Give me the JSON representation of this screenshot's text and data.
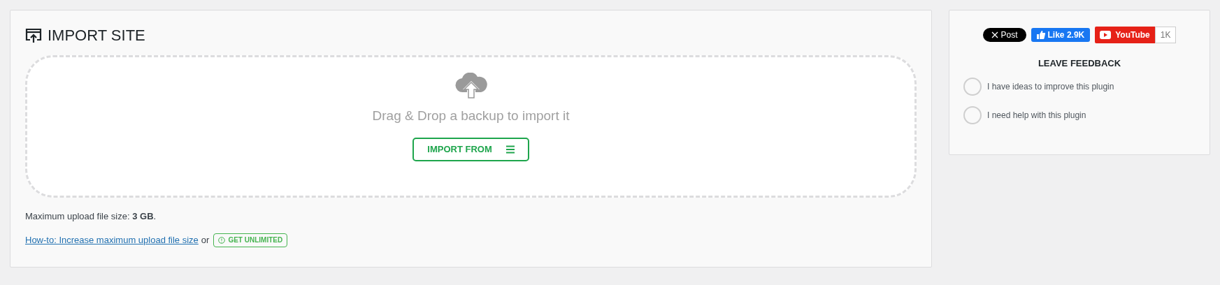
{
  "import_panel": {
    "title": "IMPORT SITE",
    "dropzone": {
      "message": "Drag & Drop a backup to import it",
      "button": "IMPORT FROM"
    },
    "max_upload": "Maximum upload file size: **3 GB**.",
    "howto_link": "How-to: Increase maximum upload file size",
    "or_text": "or",
    "upgrade_badge": "GET UNLIMITED"
  },
  "side_panel": {
    "social": {
      "x_post": "Post",
      "fb_like": "Like 2.9K",
      "youtube": "YouTube",
      "youtube_count": "1K"
    },
    "feedback_title": "LEAVE FEEDBACK",
    "options": [
      {
        "label": "I have ideas to improve this plugin",
        "selected": false
      },
      {
        "label": "I need help with this plugin",
        "selected": false
      }
    ]
  }
}
